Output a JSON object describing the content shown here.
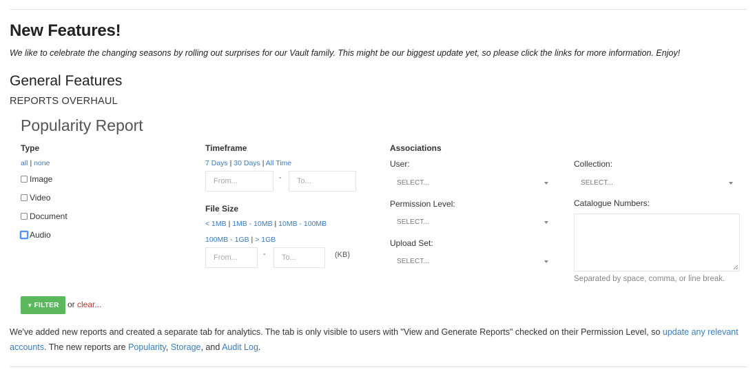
{
  "header": {
    "title": "New Features!",
    "intro": "We like to celebrate the changing seasons by rolling out surprises for our Vault family. This might be our biggest update yet, so please click the links for more information. Enjoy!"
  },
  "section": {
    "title": "General Features",
    "subsection": "REPORTS OVERHAUL"
  },
  "report": {
    "title": "Popularity Report",
    "type": {
      "label": "Type",
      "all": "all",
      "sep": "|",
      "none": "none",
      "options": [
        "Image",
        "Video",
        "Document",
        "Audio"
      ]
    },
    "timeframe": {
      "label": "Timeframe",
      "links": [
        "7 Days",
        "30 Days",
        "All Time"
      ],
      "sep": "|",
      "from_placeholder": "From...",
      "to_placeholder": "To...",
      "dash": "-"
    },
    "filesize": {
      "label": "File Size",
      "links_row1": [
        "< 1MB",
        "1MB - 10MB",
        "10MB - 100MB"
      ],
      "links_row2": [
        "100MB - 1GB",
        "> 1GB"
      ],
      "sep": "|",
      "from_placeholder": "From...",
      "to_placeholder": "To...",
      "dash": "-",
      "unit": "(KB)"
    },
    "associations": {
      "label": "Associations",
      "user_label": "User:",
      "user_value": "SELECT...",
      "permission_label": "Permission Level:",
      "permission_value": "SELECT...",
      "upload_label": "Upload Set:",
      "upload_value": "SELECT..."
    },
    "collection": {
      "label": "Collection:",
      "value": "SELECT..."
    },
    "catalogue": {
      "label": "Catalogue Numbers:",
      "help": "Separated by space, comma, or line break."
    },
    "filter_button": "FILTER",
    "or_text": "or",
    "clear_link": "clear..."
  },
  "description": {
    "part1": "We've added new reports and created a separate tab for analytics. The tab is only visible to users with \"View and Generate Reports\" checked on their Permission Level, so ",
    "link_accounts": "update any relevant accounts",
    "part2": ". The new reports are ",
    "link_popularity": "Popularity",
    "comma": ", ",
    "link_storage": "Storage",
    "and": ", and ",
    "link_audit": "Audit Log",
    "end": "."
  },
  "colors": {
    "link": "#3a7bbf",
    "button": "#5cb85c",
    "clear": "#b03a2e"
  }
}
